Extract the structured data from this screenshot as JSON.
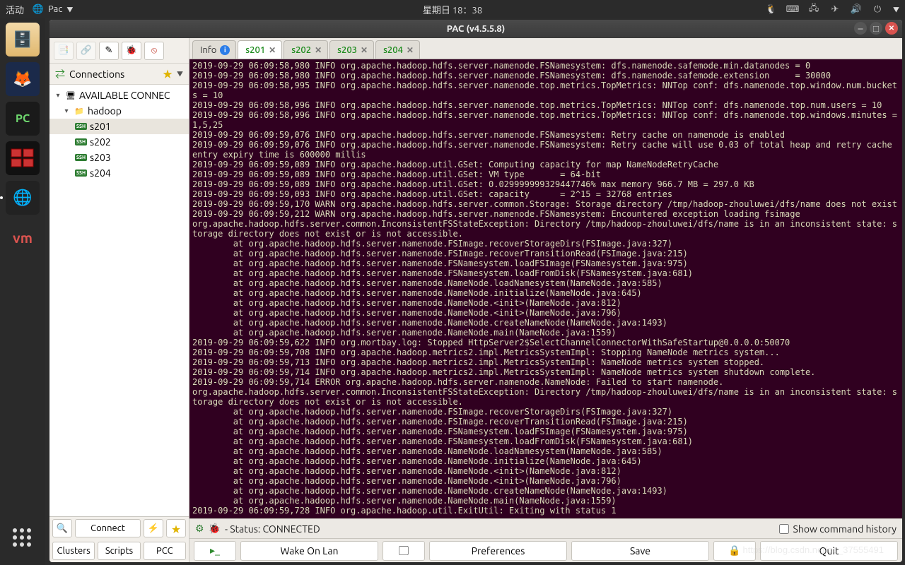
{
  "topbar": {
    "activities": "活动",
    "app": "Pac",
    "clock": "星期日 18：38"
  },
  "window": {
    "title": "PAC (v4.5.5.8)"
  },
  "sidebar": {
    "header": "Connections",
    "tree": {
      "root": "AVAILABLE CONNEC",
      "group": "hadoop",
      "items": [
        "s201",
        "s202",
        "s203",
        "s204"
      ],
      "selected": "s201"
    },
    "connect": "Connect",
    "btns": {
      "clusters": "Clusters",
      "scripts": "Scripts",
      "pcc": "PCC"
    }
  },
  "tabs": {
    "info": "Info",
    "list": [
      "s201",
      "s202",
      "s203",
      "s204"
    ],
    "active": "s201"
  },
  "status": {
    "label": "- Status: CONNECTED",
    "history": "Show command history"
  },
  "mainbtns": {
    "wol": "Wake On Lan",
    "prefs": "Preferences",
    "save": "Save",
    "quit": "Quit"
  },
  "watermark": "https://blog.csdn.net/qq_37555491",
  "terminal": "2019-09-29 06:09:58,980 INFO org.apache.hadoop.hdfs.server.namenode.FSNamesystem: dfs.namenode.safemode.min.datanodes = 0\n2019-09-29 06:09:58,980 INFO org.apache.hadoop.hdfs.server.namenode.FSNamesystem: dfs.namenode.safemode.extension     = 30000\n2019-09-29 06:09:58,995 INFO org.apache.hadoop.hdfs.server.namenode.top.metrics.TopMetrics: NNTop conf: dfs.namenode.top.window.num.buckets = 10\n2019-09-29 06:09:58,996 INFO org.apache.hadoop.hdfs.server.namenode.top.metrics.TopMetrics: NNTop conf: dfs.namenode.top.num.users = 10\n2019-09-29 06:09:58,996 INFO org.apache.hadoop.hdfs.server.namenode.top.metrics.TopMetrics: NNTop conf: dfs.namenode.top.windows.minutes = 1,5,25\n2019-09-29 06:09:59,076 INFO org.apache.hadoop.hdfs.server.namenode.FSNamesystem: Retry cache on namenode is enabled\n2019-09-29 06:09:59,076 INFO org.apache.hadoop.hdfs.server.namenode.FSNamesystem: Retry cache will use 0.03 of total heap and retry cache entry expiry time is 600000 millis\n2019-09-29 06:09:59,089 INFO org.apache.hadoop.util.GSet: Computing capacity for map NameNodeRetryCache\n2019-09-29 06:09:59,089 INFO org.apache.hadoop.util.GSet: VM type       = 64-bit\n2019-09-29 06:09:59,089 INFO org.apache.hadoop.util.GSet: 0.029999999329447746% max memory 966.7 MB = 297.0 KB\n2019-09-29 06:09:59,093 INFO org.apache.hadoop.util.GSet: capacity      = 2^15 = 32768 entries\n2019-09-29 06:09:59,170 WARN org.apache.hadoop.hdfs.server.common.Storage: Storage directory /tmp/hadoop-zhouluwei/dfs/name does not exist\n2019-09-29 06:09:59,212 WARN org.apache.hadoop.hdfs.server.namenode.FSNamesystem: Encountered exception loading fsimage\norg.apache.hadoop.hdfs.server.common.InconsistentFSStateException: Directory /tmp/hadoop-zhouluwei/dfs/name is in an inconsistent state: storage directory does not exist or is not accessible.\n        at org.apache.hadoop.hdfs.server.namenode.FSImage.recoverStorageDirs(FSImage.java:327)\n        at org.apache.hadoop.hdfs.server.namenode.FSImage.recoverTransitionRead(FSImage.java:215)\n        at org.apache.hadoop.hdfs.server.namenode.FSNamesystem.loadFSImage(FSNamesystem.java:975)\n        at org.apache.hadoop.hdfs.server.namenode.FSNamesystem.loadFromDisk(FSNamesystem.java:681)\n        at org.apache.hadoop.hdfs.server.namenode.NameNode.loadNamesystem(NameNode.java:585)\n        at org.apache.hadoop.hdfs.server.namenode.NameNode.initialize(NameNode.java:645)\n        at org.apache.hadoop.hdfs.server.namenode.NameNode.<init>(NameNode.java:812)\n        at org.apache.hadoop.hdfs.server.namenode.NameNode.<init>(NameNode.java:796)\n        at org.apache.hadoop.hdfs.server.namenode.NameNode.createNameNode(NameNode.java:1493)\n        at org.apache.hadoop.hdfs.server.namenode.NameNode.main(NameNode.java:1559)\n2019-09-29 06:09:59,622 INFO org.mortbay.log: Stopped HttpServer2$SelectChannelConnectorWithSafeStartup@0.0.0.0:50070\n2019-09-29 06:09:59,708 INFO org.apache.hadoop.metrics2.impl.MetricsSystemImpl: Stopping NameNode metrics system...\n2019-09-29 06:09:59,713 INFO org.apache.hadoop.metrics2.impl.MetricsSystemImpl: NameNode metrics system stopped.\n2019-09-29 06:09:59,714 INFO org.apache.hadoop.metrics2.impl.MetricsSystemImpl: NameNode metrics system shutdown complete.\n2019-09-29 06:09:59,714 ERROR org.apache.hadoop.hdfs.server.namenode.NameNode: Failed to start namenode.\norg.apache.hadoop.hdfs.server.common.InconsistentFSStateException: Directory /tmp/hadoop-zhouluwei/dfs/name is in an inconsistent state: storage directory does not exist or is not accessible.\n        at org.apache.hadoop.hdfs.server.namenode.FSImage.recoverStorageDirs(FSImage.java:327)\n        at org.apache.hadoop.hdfs.server.namenode.FSImage.recoverTransitionRead(FSImage.java:215)\n        at org.apache.hadoop.hdfs.server.namenode.FSNamesystem.loadFSImage(FSNamesystem.java:975)\n        at org.apache.hadoop.hdfs.server.namenode.FSNamesystem.loadFromDisk(FSNamesystem.java:681)\n        at org.apache.hadoop.hdfs.server.namenode.NameNode.loadNamesystem(NameNode.java:585)\n        at org.apache.hadoop.hdfs.server.namenode.NameNode.initialize(NameNode.java:645)\n        at org.apache.hadoop.hdfs.server.namenode.NameNode.<init>(NameNode.java:812)\n        at org.apache.hadoop.hdfs.server.namenode.NameNode.<init>(NameNode.java:796)\n        at org.apache.hadoop.hdfs.server.namenode.NameNode.createNameNode(NameNode.java:1493)\n        at org.apache.hadoop.hdfs.server.namenode.NameNode.main(NameNode.java:1559)\n2019-09-29 06:09:59,728 INFO org.apache.hadoop.util.ExitUtil: Exiting with status 1"
}
